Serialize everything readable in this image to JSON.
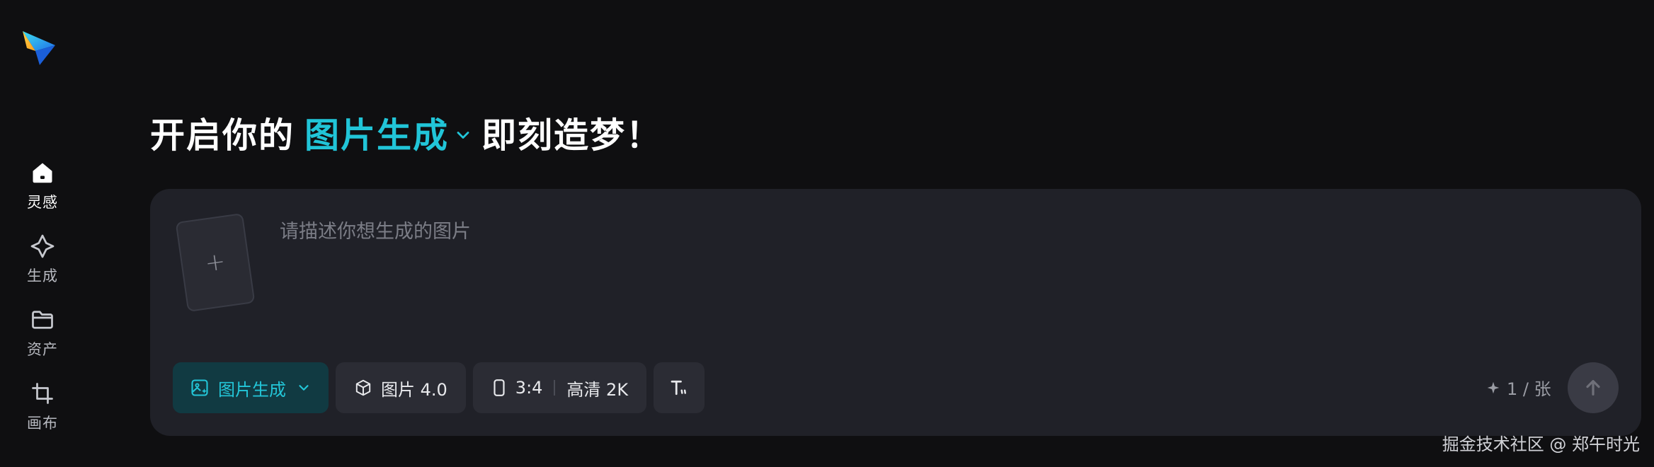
{
  "sidebar": {
    "logo_icon": "paper-plane-logo",
    "items": [
      {
        "label": "灵感",
        "icon": "home-icon",
        "active": true
      },
      {
        "label": "生成",
        "icon": "sparkle-diamond-icon",
        "active": false
      },
      {
        "label": "资产",
        "icon": "folder-icon",
        "active": false
      },
      {
        "label": "画布",
        "icon": "crop-icon",
        "active": false
      }
    ]
  },
  "heading": {
    "prefix": "开启你的",
    "mode": "图片生成",
    "suffix": "即刻造梦！"
  },
  "composer": {
    "placeholder": "请描述你想生成的图片",
    "upload_symbol": "+",
    "toolbar": {
      "mode_label": "图片生成",
      "model_label": "图片 4.0",
      "ratio_label": "3:4",
      "quality_label": "高清 2K",
      "text_icon": "text-format-icon"
    },
    "credit": "1 / 张"
  },
  "watermark": "掘金技术社区 @ 郑午时光",
  "colors": {
    "accent": "#21c5d8",
    "background": "#0f0f11",
    "panel": "#202128",
    "chip": "#2b2c34"
  }
}
